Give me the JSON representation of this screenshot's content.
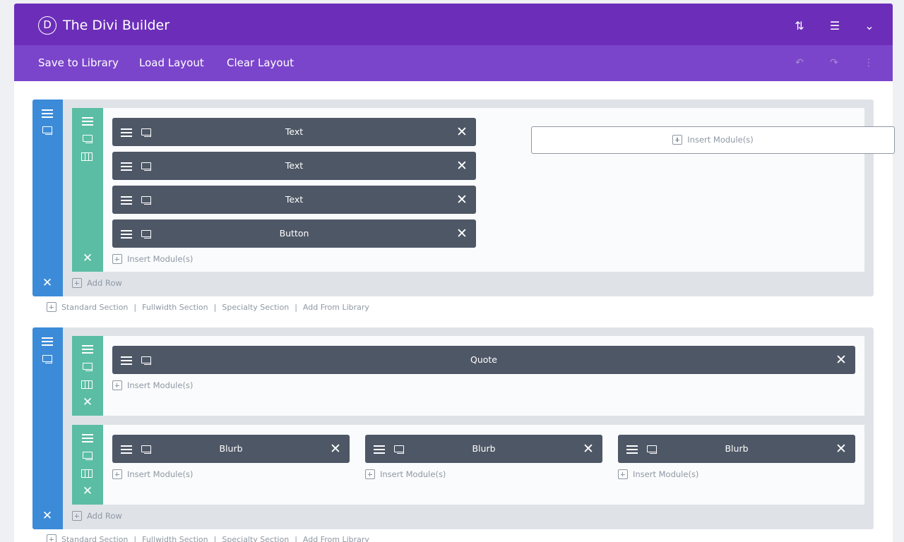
{
  "header": {
    "logo_letter": "D",
    "title": "The Divi Builder",
    "icons": [
      "sort-arrows-icon",
      "menu-icon",
      "chevron-down-icon"
    ]
  },
  "toolbar": {
    "save_label": "Save to Library",
    "load_label": "Load Layout",
    "clear_label": "Clear Layout",
    "icons": [
      "undo-icon",
      "redo-icon",
      "history-icon"
    ]
  },
  "builder": {
    "insert_label": "Insert Module(s)",
    "add_row_label": "Add Row",
    "section_links": [
      "Standard Section",
      "Fullwidth Section",
      "Specialty Section",
      "Add From Library"
    ],
    "section1": {
      "row1": {
        "column1_modules": [
          "Text",
          "Text",
          "Text",
          "Button"
        ]
      }
    },
    "section2": {
      "row1": {
        "modules": [
          "Quote"
        ]
      },
      "row2": {
        "modules": [
          "Blurb",
          "Blurb",
          "Blurb"
        ]
      }
    }
  },
  "colors": {
    "header": "#6c2eb9",
    "toolbar": "#7b45cb",
    "section": "#3c8bd8",
    "row": "#5bbda4",
    "module": "#4e5766"
  }
}
